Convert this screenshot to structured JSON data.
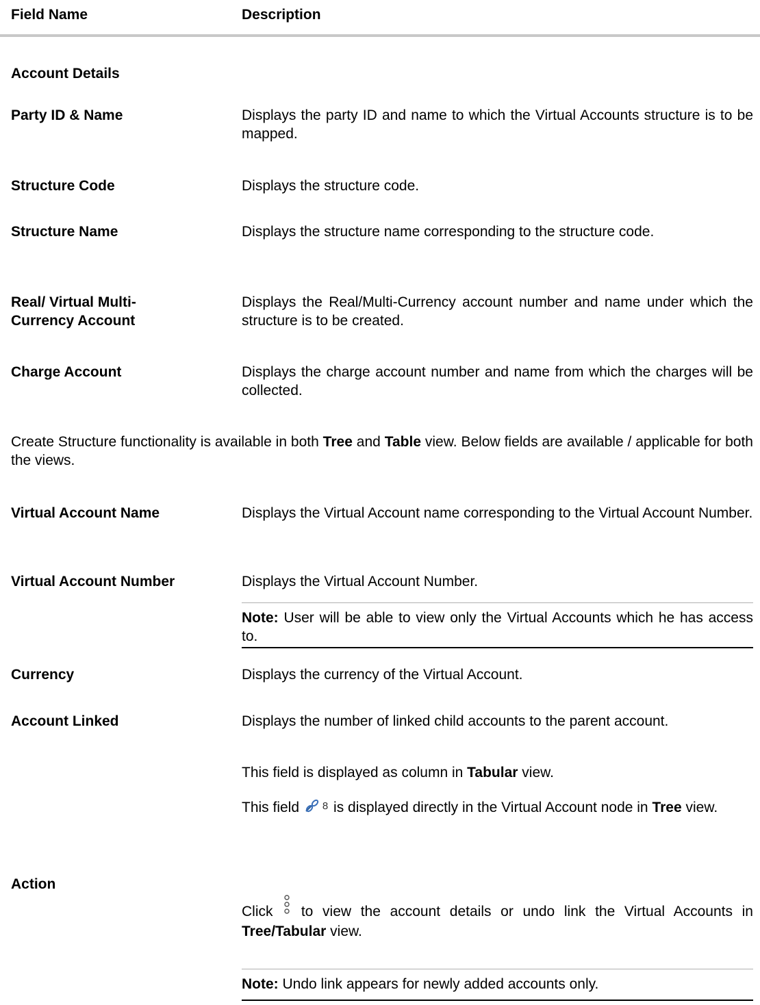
{
  "header": {
    "field_name": "Field Name",
    "description": "Description"
  },
  "section_title": "Account Details",
  "fields1": [
    {
      "label": "Party ID & Name",
      "desc": "Displays the party ID and name to which the Virtual Accounts structure is to be mapped."
    },
    {
      "label": "Structure Code",
      "desc": "Displays the structure code."
    },
    {
      "label": "Structure Name",
      "desc": "Displays the structure name corresponding to the structure code."
    },
    {
      "label_line1": "Real/ Virtual Multi-",
      "label_line2": "Currency Account",
      "desc": "Displays the Real/Multi-Currency account number and name under which the structure is to be created."
    },
    {
      "label": "Charge Account",
      "desc": "Displays the charge account number and name from which the charges will be collected."
    }
  ],
  "intro": {
    "p1": "Create Structure functionality is available in both ",
    "tree": "Tree",
    "and": " and ",
    "table": "Table",
    "p2": " view. Below fields are available / applicable for both the views."
  },
  "fields2": [
    {
      "label": "Virtual Account Name",
      "desc": "Displays the Virtual Account name corresponding to the Virtual Account Number."
    },
    {
      "label": "Virtual Account Number",
      "desc": "Displays the Virtual Account Number.",
      "note_bold": "Note:",
      "note_text": " User will be able to view only the Virtual Accounts which he has access to."
    },
    {
      "label": "Currency",
      "desc": "Displays the currency of the Virtual Account."
    },
    {
      "label": "Account Linked",
      "desc": "Displays the number of linked child accounts to the parent account.",
      "p2_a": "This field is displayed as column in ",
      "p2_b": "Tabular",
      "p2_c": " view.",
      "p3_a": "This field ",
      "link_count": "8",
      "p3_b": " is displayed directly in the Virtual Account node in ",
      "p3_c": "Tree",
      "p3_d": " view."
    },
    {
      "label": "Action",
      "d_a": "Click ",
      "d_b": " to view the account details or undo link the Virtual Accounts in ",
      "d_c": "Tree/Tabular",
      "d_d": " view.",
      "note_bold": "Note:",
      "note_text": " Undo link appears for newly added accounts only."
    }
  ],
  "icons": {
    "link": "link-icon",
    "kebab": "kebab-menu-icon"
  }
}
